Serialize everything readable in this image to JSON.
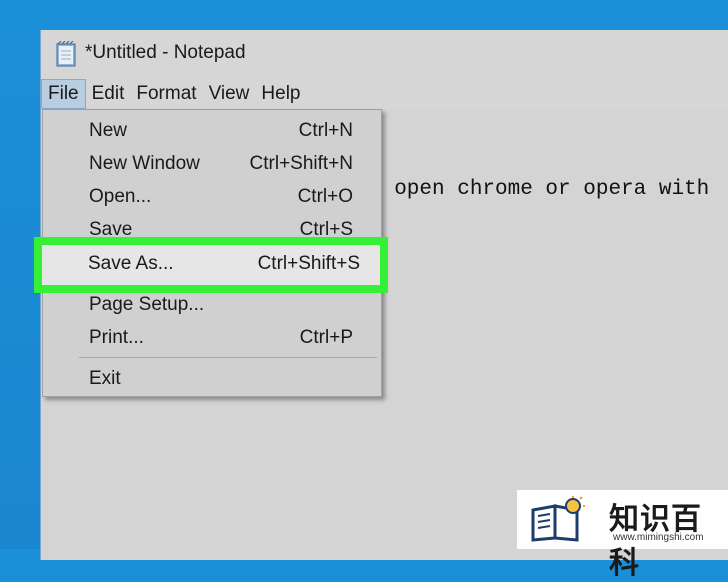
{
  "window": {
    "title": "*Untitled - Notepad",
    "icon": "notepad-icon"
  },
  "menubar": {
    "items": [
      "File",
      "Edit",
      "Format",
      "View",
      "Help"
    ],
    "active": "File"
  },
  "editor": {
    "visible_text": "o open chrome or opera with"
  },
  "file_menu": {
    "items": [
      {
        "label": "New",
        "shortcut": "Ctrl+N"
      },
      {
        "label": "New Window",
        "shortcut": "Ctrl+Shift+N"
      },
      {
        "label": "Open...",
        "shortcut": "Ctrl+O"
      },
      {
        "label": "Save",
        "shortcut": "Ctrl+S"
      },
      {
        "label": "Save As...",
        "shortcut": "Ctrl+Shift+S",
        "highlighted": true
      },
      {
        "label": "Page Setup...",
        "shortcut": ""
      },
      {
        "label": "Print...",
        "shortcut": "Ctrl+P"
      },
      {
        "label": "Exit",
        "shortcut": ""
      }
    ]
  },
  "highlight_color": "#35f035",
  "watermark": {
    "text": "知识百科",
    "url": "www.mimingshi.com"
  }
}
